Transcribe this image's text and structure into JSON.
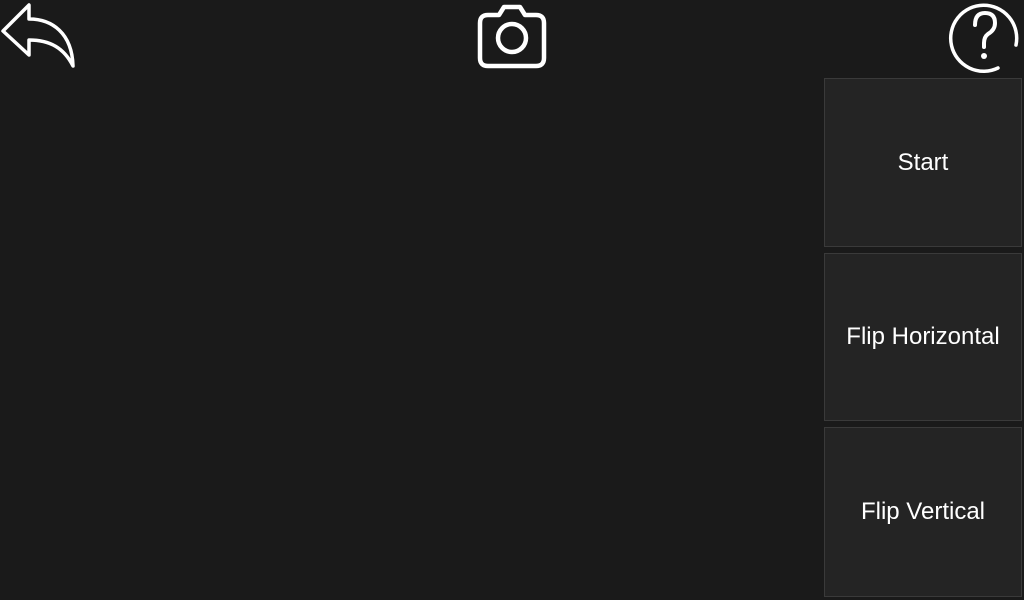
{
  "toolbar": {
    "back_icon": "back-arrow-icon",
    "camera_icon": "camera-icon",
    "help_icon": "help-icon"
  },
  "controls": {
    "start_label": "Start",
    "flip_horizontal_label": "Flip Horizontal",
    "flip_vertical_label": "Flip Vertical"
  },
  "colors": {
    "background": "#1a1a1a",
    "button_background": "#242424",
    "button_border": "#3a3a3a",
    "icon_color": "#ffffff",
    "text_color": "#ffffff"
  }
}
